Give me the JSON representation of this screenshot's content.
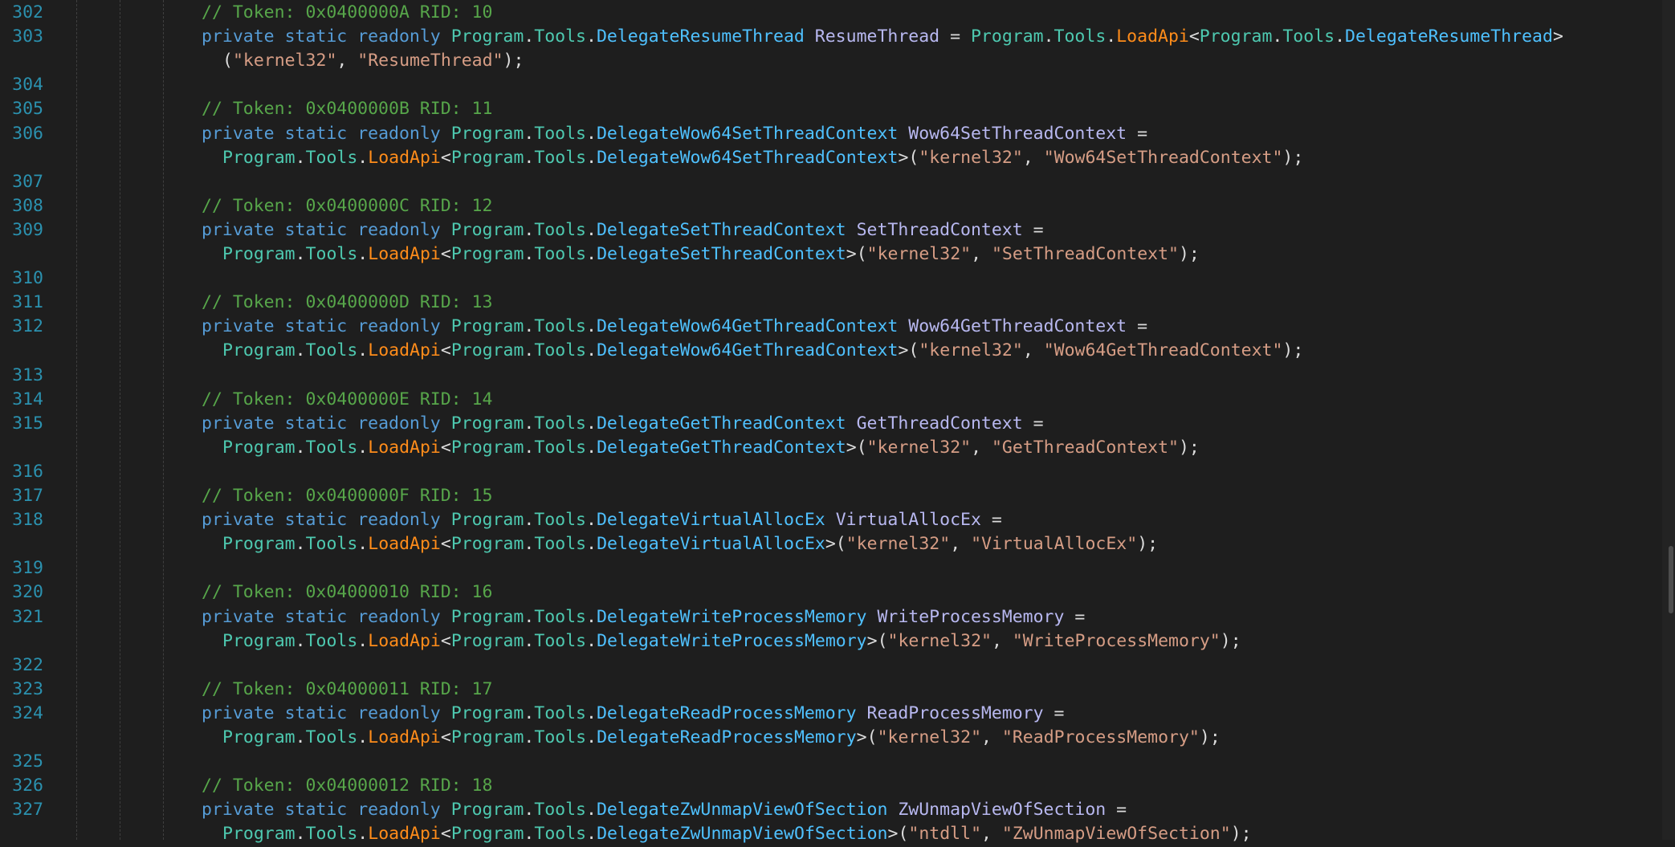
{
  "editor": {
    "language": "C#",
    "rows": [
      {
        "line": "302",
        "kind": "comment",
        "text": "// Token: 0x0400000A RID: 10"
      },
      {
        "line": "303",
        "kind": "decl",
        "delegate": "DelegateResumeThread",
        "field": "ResumeThread",
        "wrap": "before-paren"
      },
      {
        "line": "",
        "kind": "cont-args",
        "dll": "kernel32",
        "api": "ResumeThread"
      },
      {
        "line": "304",
        "kind": "blank"
      },
      {
        "line": "305",
        "kind": "comment",
        "text": "// Token: 0x0400000B RID: 11"
      },
      {
        "line": "306",
        "kind": "decl",
        "delegate": "DelegateWow64SetThreadContext",
        "field": "Wow64SetThreadContext",
        "wrap": "after-equals"
      },
      {
        "line": "",
        "kind": "cont-full",
        "delegate": "DelegateWow64SetThreadContext",
        "dll": "kernel32",
        "api": "Wow64SetThreadContext"
      },
      {
        "line": "307",
        "kind": "blank"
      },
      {
        "line": "308",
        "kind": "comment",
        "text": "// Token: 0x0400000C RID: 12"
      },
      {
        "line": "309",
        "kind": "decl",
        "delegate": "DelegateSetThreadContext",
        "field": "SetThreadContext",
        "wrap": "after-equals"
      },
      {
        "line": "",
        "kind": "cont-full",
        "delegate": "DelegateSetThreadContext",
        "dll": "kernel32",
        "api": "SetThreadContext"
      },
      {
        "line": "310",
        "kind": "blank"
      },
      {
        "line": "311",
        "kind": "comment",
        "text": "// Token: 0x0400000D RID: 13"
      },
      {
        "line": "312",
        "kind": "decl",
        "delegate": "DelegateWow64GetThreadContext",
        "field": "Wow64GetThreadContext",
        "wrap": "after-equals"
      },
      {
        "line": "",
        "kind": "cont-full",
        "delegate": "DelegateWow64GetThreadContext",
        "dll": "kernel32",
        "api": "Wow64GetThreadContext"
      },
      {
        "line": "313",
        "kind": "blank"
      },
      {
        "line": "314",
        "kind": "comment",
        "text": "// Token: 0x0400000E RID: 14"
      },
      {
        "line": "315",
        "kind": "decl",
        "delegate": "DelegateGetThreadContext",
        "field": "GetThreadContext",
        "wrap": "after-equals"
      },
      {
        "line": "",
        "kind": "cont-full",
        "delegate": "DelegateGetThreadContext",
        "dll": "kernel32",
        "api": "GetThreadContext"
      },
      {
        "line": "316",
        "kind": "blank"
      },
      {
        "line": "317",
        "kind": "comment",
        "text": "// Token: 0x0400000F RID: 15"
      },
      {
        "line": "318",
        "kind": "decl",
        "delegate": "DelegateVirtualAllocEx",
        "field": "VirtualAllocEx",
        "wrap": "after-equals"
      },
      {
        "line": "",
        "kind": "cont-full",
        "delegate": "DelegateVirtualAllocEx",
        "dll": "kernel32",
        "api": "VirtualAllocEx"
      },
      {
        "line": "319",
        "kind": "blank"
      },
      {
        "line": "320",
        "kind": "comment",
        "text": "// Token: 0x04000010 RID: 16"
      },
      {
        "line": "321",
        "kind": "decl",
        "delegate": "DelegateWriteProcessMemory",
        "field": "WriteProcessMemory",
        "wrap": "after-equals"
      },
      {
        "line": "",
        "kind": "cont-full",
        "delegate": "DelegateWriteProcessMemory",
        "dll": "kernel32",
        "api": "WriteProcessMemory"
      },
      {
        "line": "322",
        "kind": "blank"
      },
      {
        "line": "323",
        "kind": "comment",
        "text": "// Token: 0x04000011 RID: 17"
      },
      {
        "line": "324",
        "kind": "decl",
        "delegate": "DelegateReadProcessMemory",
        "field": "ReadProcessMemory",
        "wrap": "after-equals"
      },
      {
        "line": "",
        "kind": "cont-full",
        "delegate": "DelegateReadProcessMemory",
        "dll": "kernel32",
        "api": "ReadProcessMemory"
      },
      {
        "line": "325",
        "kind": "blank"
      },
      {
        "line": "326",
        "kind": "comment",
        "text": "// Token: 0x04000012 RID: 18"
      },
      {
        "line": "327",
        "kind": "decl",
        "delegate": "DelegateZwUnmapViewOfSection",
        "field": "ZwUnmapViewOfSection",
        "wrap": "after-equals"
      },
      {
        "line": "",
        "kind": "cont-full",
        "delegate": "DelegateZwUnmapViewOfSection",
        "dll": "ntdll",
        "api": "ZwUnmapViewOfSection"
      }
    ],
    "keywords": {
      "access": "private",
      "modifier1": "static",
      "modifier2": "readonly"
    },
    "identifiers": {
      "program": "Program",
      "tools": "Tools",
      "load_api": "LoadApi"
    },
    "colors": {
      "background": "#1e1e1e",
      "line_number": "#2b91af",
      "comment": "#57a64a",
      "keyword": "#569cd6",
      "namespace": "#4ec9b0",
      "delegate_type": "#4fc1ff",
      "field": "#b8b8f0",
      "method": "#ff8c1a",
      "string": "#d69d85",
      "punctuation": "#dcdcdc"
    }
  },
  "scrollbar": {
    "position_fraction": 0.7
  }
}
